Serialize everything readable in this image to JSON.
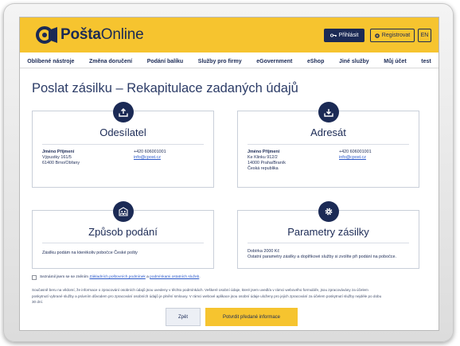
{
  "header": {
    "logo_text_bold": "Pošta",
    "logo_text_regular": "Online",
    "login_label": "Přihlásit",
    "register_label": "Registrovat",
    "lang_label": "EN"
  },
  "nav": {
    "items": [
      {
        "label": "Oblíbené nástroje"
      },
      {
        "label": "Změna doručení"
      },
      {
        "label": "Podání balíku"
      },
      {
        "label": "Služby pro firmy"
      },
      {
        "label": "eGovernment"
      },
      {
        "label": "eShop"
      },
      {
        "label": "Jiné služby"
      },
      {
        "label": "Můj účet"
      },
      {
        "label": "test"
      }
    ]
  },
  "page": {
    "title": "Poslat zásilku – Rekapitulace zadaných údajů"
  },
  "sender": {
    "title": "Odesílatel",
    "name": "Jméno Příjmení",
    "street": "Výpustky 161/5",
    "city": "61400 Brno/Obřany",
    "phone": "+420 606001001",
    "email": "info@cpost.cz"
  },
  "recipient": {
    "title": "Adresát",
    "name": "Jméno Příjmení",
    "street": "Ke Klinku 912/2",
    "city": "14000 Praha/Braník",
    "country": "Česká republika",
    "phone": "+420 606001001",
    "email": "info@cpost.cz"
  },
  "submission": {
    "title": "Způsob podání",
    "text": "Zásilku podám na kterékoliv pobočce České pošty"
  },
  "parameters": {
    "title": "Parametry zásilky",
    "cod": "Dobírka 2000 Kč",
    "text": "Ostatní parametry zásilky a doplňkové služby si zvolíte při podání na pobočce."
  },
  "consent": {
    "prefix": "Seznámil jsem se se zněním",
    "terms_link": "Základních poštovních podmínek",
    "middle": "a",
    "other_link": "podmínkami ostatních služeb",
    "suffix": "."
  },
  "privacy_text": "Současně beru na vědomí, že informace o zpracování osobních údajů jsou uvedeny v těchto podmínkách. Veškeré osobní údaje, které jsem uvedl/a v rámci webového formuláře, jsou zpracovávány za účelem poskytnutí vybrané služby a právním důvodem pro zpracování osobních údajů je plnění smlouvy. V rámci webové aplikace jsou osobní údaje uloženy pro jejich zpracování za účelem poskytnutí služby nejdéle po dobu 30 dní.",
  "buttons": {
    "back": "Zpět",
    "confirm": "Potvrdit předané informace"
  },
  "colors": {
    "brand_yellow": "#f6c42f",
    "brand_navy": "#1b2a55",
    "link_blue": "#2a58c9"
  },
  "icons": {
    "sender": "upload-tray-icon",
    "recipient": "download-tray-icon",
    "submission": "building-people-icon",
    "parameters": "gear-icon"
  }
}
